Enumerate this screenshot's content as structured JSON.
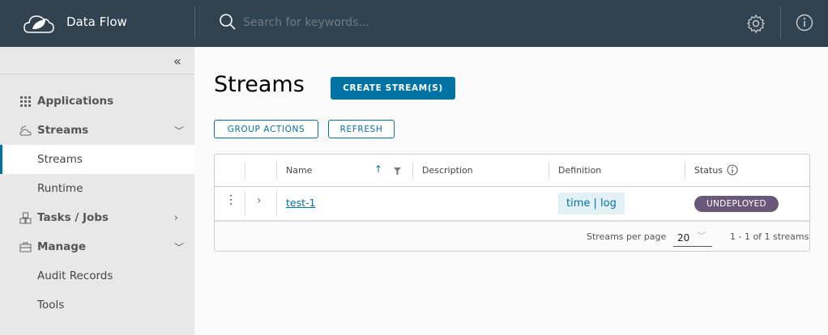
{
  "header": {
    "brand": "Data Flow",
    "search_placeholder": "Search for keywords...",
    "icons": [
      "settings-icon",
      "info-icon"
    ]
  },
  "sidebar": {
    "items": [
      {
        "label": "Applications",
        "icon": "grid-icon"
      },
      {
        "label": "Streams",
        "icon": "streams-icon"
      },
      {
        "label": "Streams"
      },
      {
        "label": "Runtime"
      },
      {
        "label": "Tasks / Jobs",
        "icon": "tasks-icon"
      },
      {
        "label": "Manage",
        "icon": "briefcase-icon"
      },
      {
        "label": "Audit Records"
      },
      {
        "label": "Tools"
      }
    ]
  },
  "main": {
    "title": "Streams",
    "create_label": "CREATE STREAM(S)",
    "group_actions_label": "GROUP ACTIONS",
    "refresh_label": "REFRESH",
    "table": {
      "columns": [
        "Name",
        "Description",
        "Definition",
        "Status"
      ],
      "rows": [
        {
          "name": "test-1",
          "description": "",
          "definition": "time | log",
          "status": "UNDEPLOYED"
        }
      ],
      "per_page_label": "Streams per page",
      "per_page": "20",
      "range": "1 - 1 of 1 streams"
    }
  },
  "colors": {
    "header": "#314351",
    "accent": "#0072a3",
    "status": "#6a5878"
  }
}
